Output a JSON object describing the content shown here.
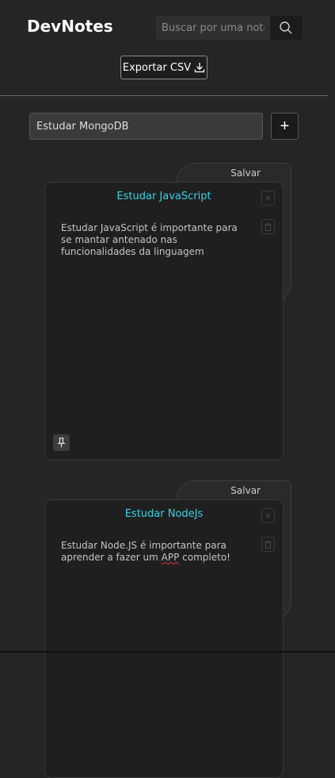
{
  "header": {
    "app_title": "DevNotes",
    "search": {
      "placeholder": "Buscar por uma nota",
      "value": "",
      "icon": "search-icon"
    },
    "export_label": "Exportar CSV",
    "export_icon": "download-icon"
  },
  "new_note": {
    "value": "Estudar MongoDB",
    "add_label": "+"
  },
  "notes": [
    {
      "save_label": "Salvar",
      "title": "Estudar JavaScript",
      "body": "Estudar JavaScript é importante para se mantar antenado nas funcionalidades da linguagem",
      "pin_icon": "pin-icon"
    },
    {
      "save_label": "Salvar",
      "title": "Estudar NodeJs",
      "body_before": "Estudar Node.JS é importante para aprender a fazer um ",
      "body_typo": "APP",
      "body_after": " completo!"
    }
  ],
  "colors": {
    "background": "#252525",
    "note_title": "#34d3e3",
    "card": "#1f1f1f"
  }
}
